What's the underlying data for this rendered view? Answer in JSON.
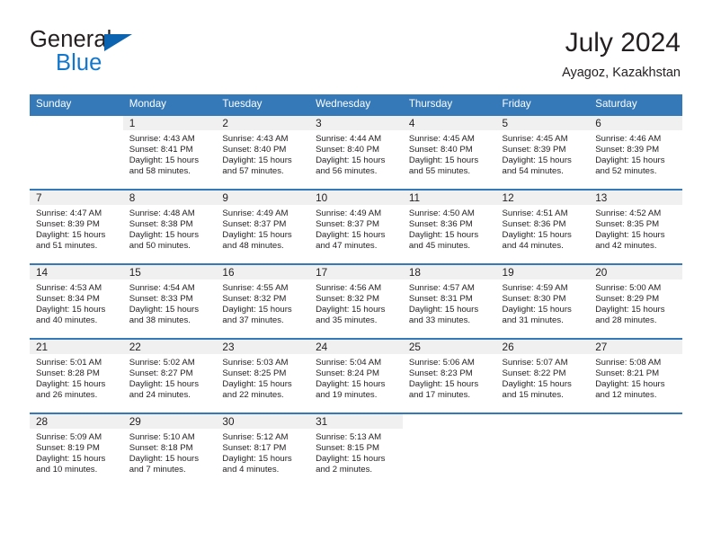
{
  "brand": {
    "name_top": "General",
    "name_bottom": "Blue",
    "triangle_color": "#0c63b0",
    "blue_color": "#1277cc"
  },
  "header": {
    "month_title": "July 2024",
    "location": "Ayagoz, Kazakhstan"
  },
  "theme": {
    "header_bg": "#3579b8",
    "header_text": "#ffffff",
    "shade_bg": "#f0f0f0",
    "text": "#231f20"
  },
  "weekday_headers": [
    "Sunday",
    "Monday",
    "Tuesday",
    "Wednesday",
    "Thursday",
    "Friday",
    "Saturday"
  ],
  "weeks": [
    [
      {
        "day": "",
        "sunrise": "",
        "sunset": "",
        "daylight_l1": "",
        "daylight_l2": ""
      },
      {
        "day": "1",
        "sunrise": "Sunrise: 4:43 AM",
        "sunset": "Sunset: 8:41 PM",
        "daylight_l1": "Daylight: 15 hours",
        "daylight_l2": "and 58 minutes."
      },
      {
        "day": "2",
        "sunrise": "Sunrise: 4:43 AM",
        "sunset": "Sunset: 8:40 PM",
        "daylight_l1": "Daylight: 15 hours",
        "daylight_l2": "and 57 minutes."
      },
      {
        "day": "3",
        "sunrise": "Sunrise: 4:44 AM",
        "sunset": "Sunset: 8:40 PM",
        "daylight_l1": "Daylight: 15 hours",
        "daylight_l2": "and 56 minutes."
      },
      {
        "day": "4",
        "sunrise": "Sunrise: 4:45 AM",
        "sunset": "Sunset: 8:40 PM",
        "daylight_l1": "Daylight: 15 hours",
        "daylight_l2": "and 55 minutes."
      },
      {
        "day": "5",
        "sunrise": "Sunrise: 4:45 AM",
        "sunset": "Sunset: 8:39 PM",
        "daylight_l1": "Daylight: 15 hours",
        "daylight_l2": "and 54 minutes."
      },
      {
        "day": "6",
        "sunrise": "Sunrise: 4:46 AM",
        "sunset": "Sunset: 8:39 PM",
        "daylight_l1": "Daylight: 15 hours",
        "daylight_l2": "and 52 minutes."
      }
    ],
    [
      {
        "day": "7",
        "sunrise": "Sunrise: 4:47 AM",
        "sunset": "Sunset: 8:39 PM",
        "daylight_l1": "Daylight: 15 hours",
        "daylight_l2": "and 51 minutes."
      },
      {
        "day": "8",
        "sunrise": "Sunrise: 4:48 AM",
        "sunset": "Sunset: 8:38 PM",
        "daylight_l1": "Daylight: 15 hours",
        "daylight_l2": "and 50 minutes."
      },
      {
        "day": "9",
        "sunrise": "Sunrise: 4:49 AM",
        "sunset": "Sunset: 8:37 PM",
        "daylight_l1": "Daylight: 15 hours",
        "daylight_l2": "and 48 minutes."
      },
      {
        "day": "10",
        "sunrise": "Sunrise: 4:49 AM",
        "sunset": "Sunset: 8:37 PM",
        "daylight_l1": "Daylight: 15 hours",
        "daylight_l2": "and 47 minutes."
      },
      {
        "day": "11",
        "sunrise": "Sunrise: 4:50 AM",
        "sunset": "Sunset: 8:36 PM",
        "daylight_l1": "Daylight: 15 hours",
        "daylight_l2": "and 45 minutes."
      },
      {
        "day": "12",
        "sunrise": "Sunrise: 4:51 AM",
        "sunset": "Sunset: 8:36 PM",
        "daylight_l1": "Daylight: 15 hours",
        "daylight_l2": "and 44 minutes."
      },
      {
        "day": "13",
        "sunrise": "Sunrise: 4:52 AM",
        "sunset": "Sunset: 8:35 PM",
        "daylight_l1": "Daylight: 15 hours",
        "daylight_l2": "and 42 minutes."
      }
    ],
    [
      {
        "day": "14",
        "sunrise": "Sunrise: 4:53 AM",
        "sunset": "Sunset: 8:34 PM",
        "daylight_l1": "Daylight: 15 hours",
        "daylight_l2": "and 40 minutes."
      },
      {
        "day": "15",
        "sunrise": "Sunrise: 4:54 AM",
        "sunset": "Sunset: 8:33 PM",
        "daylight_l1": "Daylight: 15 hours",
        "daylight_l2": "and 38 minutes."
      },
      {
        "day": "16",
        "sunrise": "Sunrise: 4:55 AM",
        "sunset": "Sunset: 8:32 PM",
        "daylight_l1": "Daylight: 15 hours",
        "daylight_l2": "and 37 minutes."
      },
      {
        "day": "17",
        "sunrise": "Sunrise: 4:56 AM",
        "sunset": "Sunset: 8:32 PM",
        "daylight_l1": "Daylight: 15 hours",
        "daylight_l2": "and 35 minutes."
      },
      {
        "day": "18",
        "sunrise": "Sunrise: 4:57 AM",
        "sunset": "Sunset: 8:31 PM",
        "daylight_l1": "Daylight: 15 hours",
        "daylight_l2": "and 33 minutes."
      },
      {
        "day": "19",
        "sunrise": "Sunrise: 4:59 AM",
        "sunset": "Sunset: 8:30 PM",
        "daylight_l1": "Daylight: 15 hours",
        "daylight_l2": "and 31 minutes."
      },
      {
        "day": "20",
        "sunrise": "Sunrise: 5:00 AM",
        "sunset": "Sunset: 8:29 PM",
        "daylight_l1": "Daylight: 15 hours",
        "daylight_l2": "and 28 minutes."
      }
    ],
    [
      {
        "day": "21",
        "sunrise": "Sunrise: 5:01 AM",
        "sunset": "Sunset: 8:28 PM",
        "daylight_l1": "Daylight: 15 hours",
        "daylight_l2": "and 26 minutes."
      },
      {
        "day": "22",
        "sunrise": "Sunrise: 5:02 AM",
        "sunset": "Sunset: 8:27 PM",
        "daylight_l1": "Daylight: 15 hours",
        "daylight_l2": "and 24 minutes."
      },
      {
        "day": "23",
        "sunrise": "Sunrise: 5:03 AM",
        "sunset": "Sunset: 8:25 PM",
        "daylight_l1": "Daylight: 15 hours",
        "daylight_l2": "and 22 minutes."
      },
      {
        "day": "24",
        "sunrise": "Sunrise: 5:04 AM",
        "sunset": "Sunset: 8:24 PM",
        "daylight_l1": "Daylight: 15 hours",
        "daylight_l2": "and 19 minutes."
      },
      {
        "day": "25",
        "sunrise": "Sunrise: 5:06 AM",
        "sunset": "Sunset: 8:23 PM",
        "daylight_l1": "Daylight: 15 hours",
        "daylight_l2": "and 17 minutes."
      },
      {
        "day": "26",
        "sunrise": "Sunrise: 5:07 AM",
        "sunset": "Sunset: 8:22 PM",
        "daylight_l1": "Daylight: 15 hours",
        "daylight_l2": "and 15 minutes."
      },
      {
        "day": "27",
        "sunrise": "Sunrise: 5:08 AM",
        "sunset": "Sunset: 8:21 PM",
        "daylight_l1": "Daylight: 15 hours",
        "daylight_l2": "and 12 minutes."
      }
    ],
    [
      {
        "day": "28",
        "sunrise": "Sunrise: 5:09 AM",
        "sunset": "Sunset: 8:19 PM",
        "daylight_l1": "Daylight: 15 hours",
        "daylight_l2": "and 10 minutes."
      },
      {
        "day": "29",
        "sunrise": "Sunrise: 5:10 AM",
        "sunset": "Sunset: 8:18 PM",
        "daylight_l1": "Daylight: 15 hours",
        "daylight_l2": "and 7 minutes."
      },
      {
        "day": "30",
        "sunrise": "Sunrise: 5:12 AM",
        "sunset": "Sunset: 8:17 PM",
        "daylight_l1": "Daylight: 15 hours",
        "daylight_l2": "and 4 minutes."
      },
      {
        "day": "31",
        "sunrise": "Sunrise: 5:13 AM",
        "sunset": "Sunset: 8:15 PM",
        "daylight_l1": "Daylight: 15 hours",
        "daylight_l2": "and 2 minutes."
      },
      {
        "day": "",
        "sunrise": "",
        "sunset": "",
        "daylight_l1": "",
        "daylight_l2": ""
      },
      {
        "day": "",
        "sunrise": "",
        "sunset": "",
        "daylight_l1": "",
        "daylight_l2": ""
      },
      {
        "day": "",
        "sunrise": "",
        "sunset": "",
        "daylight_l1": "",
        "daylight_l2": ""
      }
    ]
  ]
}
